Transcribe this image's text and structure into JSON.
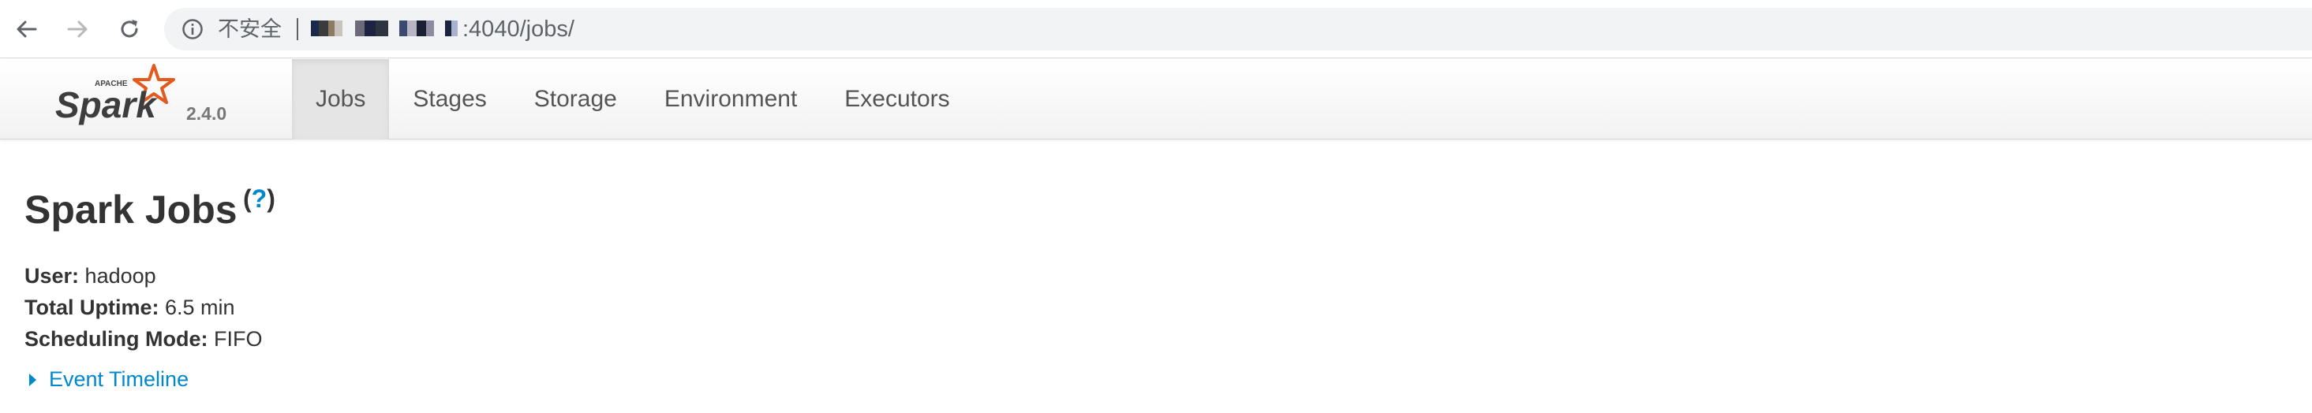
{
  "browser": {
    "security_label": "不安全",
    "url": ":4040/jobs/"
  },
  "spark_nav": {
    "logo_top": "APACHE",
    "logo_text": "Spark",
    "version": "2.4.0",
    "tabs": [
      {
        "label": "Jobs",
        "active": true
      },
      {
        "label": "Stages",
        "active": false
      },
      {
        "label": "Storage",
        "active": false
      },
      {
        "label": "Environment",
        "active": false
      },
      {
        "label": "Executors",
        "active": false
      }
    ]
  },
  "content": {
    "title": "Spark Jobs",
    "help_open": "(",
    "help_q": "?",
    "help_close": ")",
    "user_label": "User:",
    "user_value": "hadoop",
    "uptime_label": "Total Uptime:",
    "uptime_value": "6.5 min",
    "scheduling_label": "Scheduling Mode:",
    "scheduling_value": "FIFO",
    "event_timeline": "Event Timeline"
  },
  "colors": {
    "link": "#0088cc",
    "spark_orange": "#e25a1c",
    "text": "#333333"
  }
}
